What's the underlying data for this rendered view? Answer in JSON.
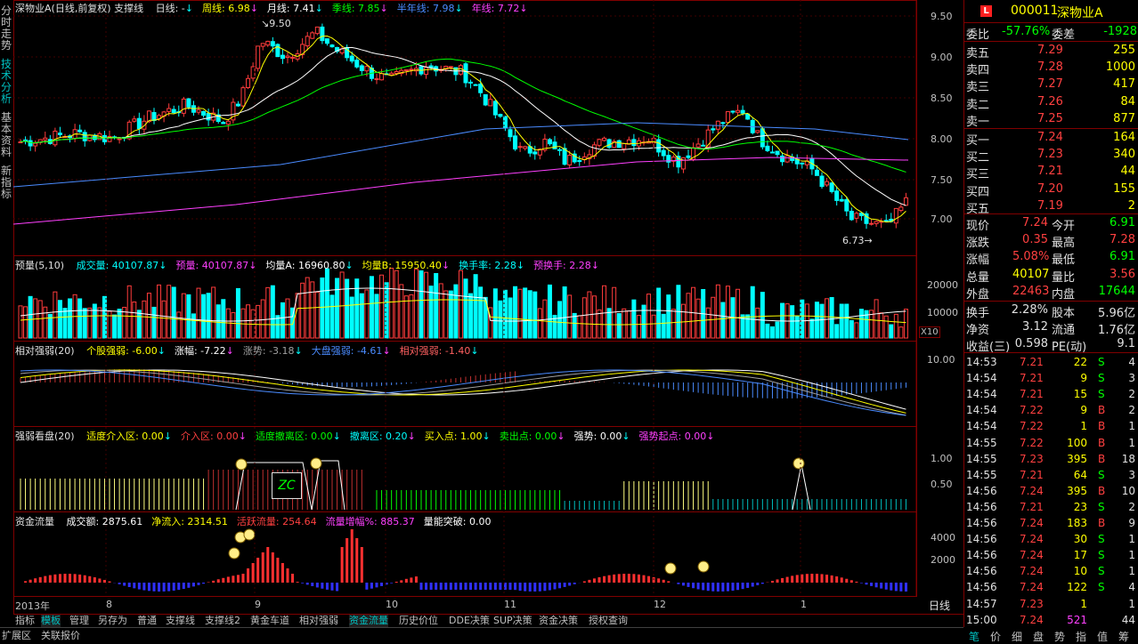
{
  "left_tabs": [
    {
      "label": "分时走势"
    },
    {
      "label": "技术分析"
    },
    {
      "label": "基本资料"
    },
    {
      "label": "新指标"
    }
  ],
  "main_header": {
    "title": "深物业A(日线,前复权) 支撑线",
    "items": [
      {
        "text": "日线: -",
        "color": "#e0e0e0"
      },
      {
        "text": "周线: 6.98",
        "color": "#ffff00"
      },
      {
        "text": "月线: 7.41",
        "color": "#ffffff"
      },
      {
        "text": "季线: 7.85",
        "color": "#00ff00"
      },
      {
        "text": "半年线: 7.98",
        "color": "#4a8bff"
      },
      {
        "text": "年线: 7.72",
        "color": "#ff40ff"
      }
    ]
  },
  "price_axis": [
    "9.50",
    "9.00",
    "8.50",
    "8.00",
    "7.50",
    "7.00"
  ],
  "annotations": {
    "high": "9.50",
    "low": "6.73"
  },
  "vol_header": {
    "title": "预量(5,10)",
    "items": [
      {
        "text": "成交量: 40107.87",
        "color": "#00ffff"
      },
      {
        "text": "预量: 40107.87",
        "color": "#ff40ff"
      },
      {
        "text": "均量A: 16960.80",
        "color": "#ffffff"
      },
      {
        "text": "均量B: 15950.40",
        "color": "#ffff00"
      },
      {
        "text": "换手率: 2.28",
        "color": "#00ffff"
      },
      {
        "text": "预换手: 2.28",
        "color": "#ff40ff"
      }
    ]
  },
  "vol_axis": [
    "20000",
    "10000"
  ],
  "vol_unit": "X10",
  "rs_header": {
    "title": "相对强弱(20)",
    "items": [
      {
        "text": "个股强弱: -6.00",
        "color": "#ffff00"
      },
      {
        "text": "涨幅: -7.22",
        "color": "#ffffff"
      },
      {
        "text": "涨势: -3.18",
        "color": "#a0a0a0"
      },
      {
        "text": "大盘强弱: -4.61",
        "color": "#4a8bff"
      },
      {
        "text": "相对强弱: -1.40",
        "color": "#ff6060"
      }
    ]
  },
  "rs_axis": [
    "10.00"
  ],
  "qr_header": {
    "title": "强弱看盘(20)",
    "items": [
      {
        "text": "适度介入区: 0.00",
        "color": "#ffff00"
      },
      {
        "text": "介入区: 0.00",
        "color": "#ff4040"
      },
      {
        "text": "适度撤离区: 0.00",
        "color": "#00ff00"
      },
      {
        "text": "撤离区: 0.20",
        "color": "#00ffff"
      },
      {
        "text": "买入点: 1.00",
        "color": "#ffff00"
      },
      {
        "text": "卖出点: 0.00",
        "color": "#00ff00"
      },
      {
        "text": "强势: 0.00",
        "color": "#ffffff"
      },
      {
        "text": "强势起点: 0.00",
        "color": "#ff40ff"
      }
    ]
  },
  "qr_axis": [
    "1.00",
    "0.50"
  ],
  "qr_badge": "ZC",
  "mf_header": {
    "title": "资金流量",
    "items": [
      {
        "text": "成交额: 2875.61",
        "color": "#ffffff"
      },
      {
        "text": "净流入: 2314.51",
        "color": "#ffff00"
      },
      {
        "text": "活跃流量: 254.64",
        "color": "#ff4040"
      },
      {
        "text": "流量增幅%: 885.37",
        "color": "#ff40ff"
      },
      {
        "text": "量能突破: 0.00",
        "color": "#ffffff"
      }
    ]
  },
  "mf_axis": [
    "4000",
    "2000"
  ],
  "x_axis": [
    {
      "label": "2013年"
    },
    {
      "label": "8"
    },
    {
      "label": "9"
    },
    {
      "label": "10"
    },
    {
      "label": "11"
    },
    {
      "label": "12"
    },
    {
      "label": "1"
    }
  ],
  "period_label": "日线",
  "bottom_tabs": [
    {
      "label": "指标"
    },
    {
      "label": "模板"
    },
    {
      "label": "管理"
    },
    {
      "label": "另存为"
    },
    {
      "label": "普通"
    },
    {
      "label": "支撑线"
    },
    {
      "label": "支撑线2"
    },
    {
      "label": "黄金车道"
    },
    {
      "label": "相对强弱"
    },
    {
      "label": "资金流量"
    },
    {
      "label": "历史价位"
    },
    {
      "label": "DDE决策"
    },
    {
      "label": "SUP决策"
    },
    {
      "label": "资金决策"
    },
    {
      "label": "授权查询"
    }
  ],
  "status_tabs": [
    {
      "label": "扩展区"
    },
    {
      "label": "关联报价"
    }
  ],
  "quote": {
    "code": "000011",
    "name": "深物业A",
    "weibi": {
      "label": "委比",
      "value": "-57.76%",
      "label2": "委差",
      "value2": "-1928"
    },
    "asks": [
      {
        "label": "卖五",
        "price": "7.29",
        "vol": "255"
      },
      {
        "label": "卖四",
        "price": "7.28",
        "vol": "1000"
      },
      {
        "label": "卖三",
        "price": "7.27",
        "vol": "417"
      },
      {
        "label": "卖二",
        "price": "7.26",
        "vol": "84"
      },
      {
        "label": "卖一",
        "price": "7.25",
        "vol": "877"
      }
    ],
    "bids": [
      {
        "label": "买一",
        "price": "7.24",
        "vol": "164"
      },
      {
        "label": "买二",
        "price": "7.23",
        "vol": "340"
      },
      {
        "label": "买三",
        "price": "7.21",
        "vol": "44"
      },
      {
        "label": "买四",
        "price": "7.20",
        "vol": "155"
      },
      {
        "label": "买五",
        "price": "7.19",
        "vol": "2"
      }
    ],
    "stats": [
      {
        "l1": "现价",
        "v1": "7.24",
        "c1": "#ff4040",
        "l2": "今开",
        "v2": "6.91",
        "c2": "#00ff00"
      },
      {
        "l1": "涨跌",
        "v1": "0.35",
        "c1": "#ff4040",
        "l2": "最高",
        "v2": "7.28",
        "c2": "#ff4040"
      },
      {
        "l1": "涨幅",
        "v1": "5.08%",
        "c1": "#ff4040",
        "l2": "最低",
        "v2": "6.91",
        "c2": "#00ff00"
      },
      {
        "l1": "总量",
        "v1": "40107",
        "c1": "#ffff00",
        "l2": "量比",
        "v2": "3.56",
        "c2": "#ff4040"
      },
      {
        "l1": "外盘",
        "v1": "22463",
        "c1": "#ff4040",
        "l2": "内盘",
        "v2": "17644",
        "c2": "#00ff00"
      }
    ],
    "fund": [
      {
        "l1": "换手",
        "v1": "2.28%",
        "l2": "股本",
        "v2": "5.96亿"
      },
      {
        "l1": "净资",
        "v1": "3.12",
        "l2": "流通",
        "v2": "1.76亿"
      },
      {
        "l1": "收益(三)",
        "v1": "0.598",
        "l2": "PE(动)",
        "v2": "9.1"
      }
    ]
  },
  "ticks": [
    {
      "time": "14:53",
      "price": "7.21",
      "vol": "22",
      "side": "S",
      "n": "4"
    },
    {
      "time": "14:54",
      "price": "7.21",
      "vol": "9",
      "side": "S",
      "n": "3"
    },
    {
      "time": "14:54",
      "price": "7.21",
      "vol": "15",
      "side": "S",
      "n": "2"
    },
    {
      "time": "14:54",
      "price": "7.22",
      "vol": "9",
      "side": "B",
      "n": "2"
    },
    {
      "time": "14:54",
      "price": "7.22",
      "vol": "1",
      "side": "B",
      "n": "1"
    },
    {
      "time": "14:55",
      "price": "7.22",
      "vol": "100",
      "side": "B",
      "n": "1"
    },
    {
      "time": "14:55",
      "price": "7.23",
      "vol": "395",
      "side": "B",
      "n": "18"
    },
    {
      "time": "14:55",
      "price": "7.21",
      "vol": "64",
      "side": "S",
      "n": "3"
    },
    {
      "time": "14:56",
      "price": "7.24",
      "vol": "395",
      "side": "B",
      "n": "10"
    },
    {
      "time": "14:56",
      "price": "7.21",
      "vol": "23",
      "side": "S",
      "n": "2"
    },
    {
      "time": "14:56",
      "price": "7.24",
      "vol": "183",
      "side": "B",
      "n": "9"
    },
    {
      "time": "14:56",
      "price": "7.24",
      "vol": "30",
      "side": "S",
      "n": "1"
    },
    {
      "time": "14:56",
      "price": "7.24",
      "vol": "17",
      "side": "S",
      "n": "1"
    },
    {
      "time": "14:56",
      "price": "7.24",
      "vol": "10",
      "side": "S",
      "n": "1"
    },
    {
      "time": "14:56",
      "price": "7.24",
      "vol": "122",
      "side": "S",
      "n": "4"
    },
    {
      "time": "14:57",
      "price": "7.23",
      "vol": "1",
      "side": "",
      "n": "1"
    },
    {
      "time": "15:00",
      "price": "7.24",
      "vol": "521",
      "side": "",
      "n": "44"
    }
  ],
  "right_tabs": [
    {
      "label": "笔"
    },
    {
      "label": "价"
    },
    {
      "label": "细"
    },
    {
      "label": "盘"
    },
    {
      "label": "势"
    },
    {
      "label": "指"
    },
    {
      "label": "值"
    },
    {
      "label": "筹"
    }
  ],
  "colors": {
    "up": "#ff3c3c",
    "down": "#00ffff",
    "grid": "#800000",
    "ma5": "#ffff00",
    "ma20": "#ffffff",
    "ma60": "#00ff00",
    "ma120": "#4a8bff",
    "ma250": "#ff40ff"
  }
}
